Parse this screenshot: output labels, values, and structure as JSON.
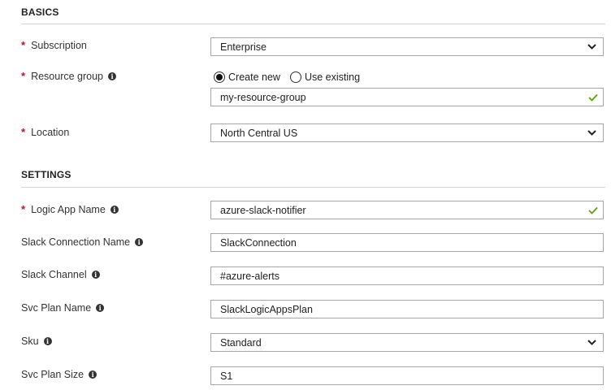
{
  "sections": {
    "basics": "BASICS",
    "settings": "SETTINGS"
  },
  "required_mark": "*",
  "info_glyph": "i",
  "fields": {
    "subscription": {
      "label": "Subscription",
      "value": "Enterprise"
    },
    "resource_group": {
      "label": "Resource group",
      "options": [
        "Create new",
        "Use existing"
      ],
      "selected": "Create new",
      "value": "my-resource-group"
    },
    "location": {
      "label": "Location",
      "value": "North Central US"
    },
    "logic_app_name": {
      "label": "Logic App Name",
      "value": "azure-slack-notifier"
    },
    "slack_connection_name": {
      "label": "Slack Connection Name",
      "value": "SlackConnection"
    },
    "slack_channel": {
      "label": "Slack Channel",
      "value": "#azure-alerts"
    },
    "svc_plan_name": {
      "label": "Svc Plan Name",
      "value": "SlackLogicAppsPlan"
    },
    "sku": {
      "label": "Sku",
      "value": "Standard"
    },
    "svc_plan_size": {
      "label": "Svc Plan Size",
      "value": "S1"
    }
  },
  "colors": {
    "required": "#c50f1f",
    "valid_check": "#57a300",
    "border": "#a6a6a6"
  }
}
